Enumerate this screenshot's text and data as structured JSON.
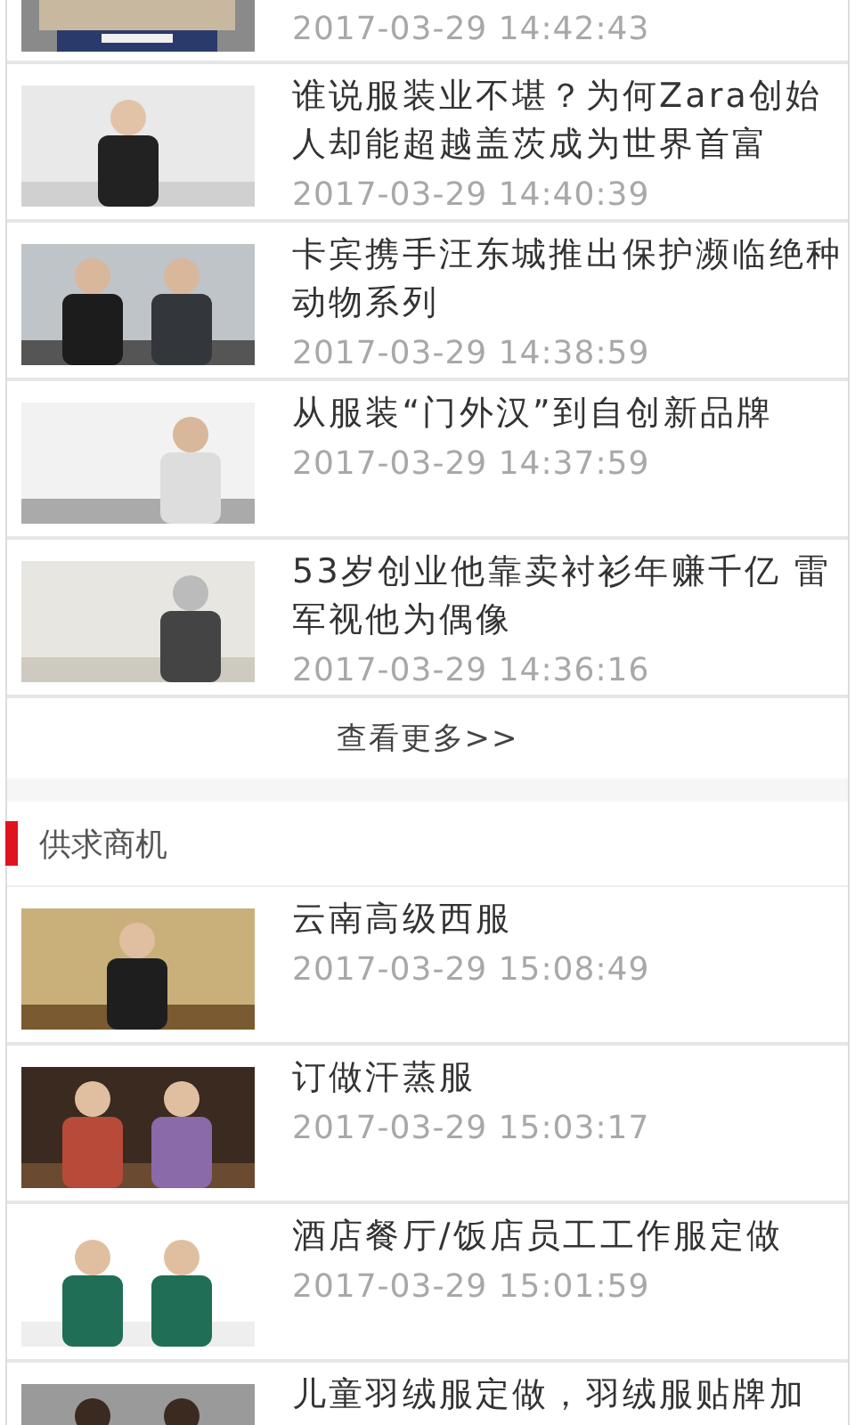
{
  "news": {
    "cut_item": {
      "time": "2017-03-29 14:42:43"
    },
    "items": [
      {
        "title": "谁说服装业不堪？为何Zara创始人却能超越盖茨成为世界首富",
        "time": "2017-03-29 14:40:39"
      },
      {
        "title": "卡宾携手汪东城推出保护濒临绝种动物系列",
        "time": "2017-03-29 14:38:59"
      },
      {
        "title": "从服装“门外汉”到自创新品牌",
        "time": "2017-03-29 14:37:59"
      },
      {
        "title": "53岁创业他靠卖衬衫年赚千亿 雷军视他为偶像",
        "time": "2017-03-29 14:36:16"
      }
    ],
    "more": "查看更多>>"
  },
  "supply": {
    "heading": "供求商机",
    "items": [
      {
        "title": "云南高级西服",
        "time": "2017-03-29 15:08:49"
      },
      {
        "title": "订做汗蒸服",
        "time": "2017-03-29 15:03:17"
      },
      {
        "title": "酒店餐厅/饭店员工工作服定做",
        "time": "2017-03-29 15:01:59"
      },
      {
        "title": "儿童羽绒服定做，羽绒服贴牌加"
      }
    ]
  }
}
